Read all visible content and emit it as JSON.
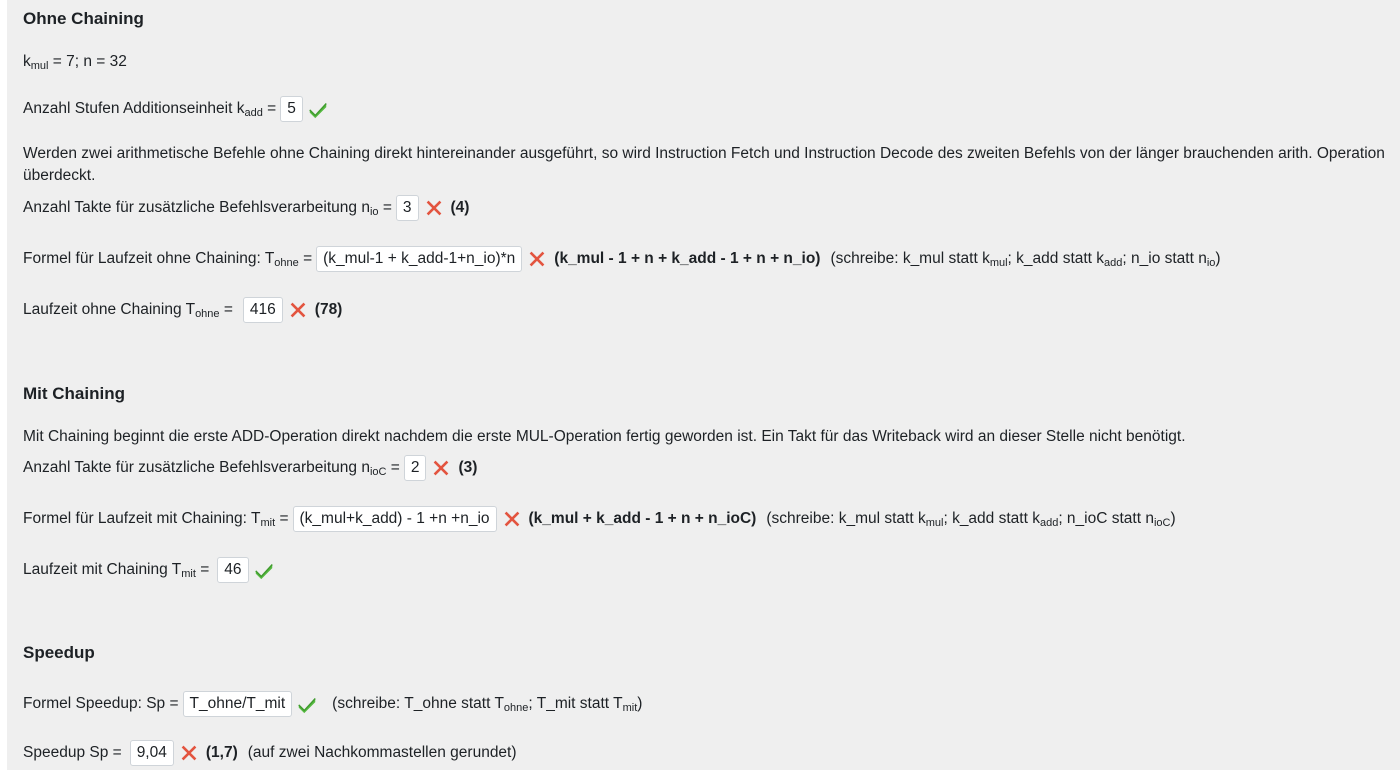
{
  "ohne": {
    "heading": "Ohne Chaining",
    "params": {
      "k": "k",
      "sub": "mul",
      "rest": " = 7; n = 32"
    },
    "stufen": {
      "label": "Anzahl Stufen Additionseinheit k",
      "sub": "add",
      "eq": " =",
      "value": "5",
      "status": "correct"
    },
    "desc": "Werden zwei arithmetische Befehle ohne Chaining direkt hintereinander ausgeführt, so wird Instruction Fetch und Instruction Decode des zweiten Befehls von der länger brauchenden arith. Operation überdeckt.",
    "takte": {
      "label": "Anzahl Takte für zusätzliche Befehlsverarbeitung n",
      "sub": "io",
      "eq": " =",
      "value": "3",
      "status": "wrong",
      "correct": "(4)"
    },
    "formel": {
      "label": "Formel für Laufzeit ohne Chaining: T",
      "sub": "ohne",
      "eq": " =",
      "value": "(k_mul-1 + k_add-1+n_io)*n",
      "status": "wrong",
      "correct": "(k_mul - 1 + n + k_add - 1 + n + n_io)",
      "note": {
        "p1": "(schreibe: k_mul statt k",
        "s1": "mul",
        "p2": "; k_add statt k",
        "s2": "add",
        "p3": "; n_io statt n",
        "s3": "io",
        "p4": ")"
      }
    },
    "laufzeit": {
      "label": "Laufzeit ohne Chaining T",
      "sub": "ohne",
      "eq": " =",
      "value": "416",
      "status": "wrong",
      "correct": "(78)"
    }
  },
  "mit": {
    "heading": "Mit Chaining",
    "desc": "Mit Chaining beginnt die erste ADD-Operation direkt nachdem die erste MUL-Operation fertig geworden ist. Ein Takt für das Writeback wird an dieser Stelle nicht benötigt.",
    "takte": {
      "label": "Anzahl Takte für zusätzliche Befehlsverarbeitung n",
      "sub": "ioC",
      "eq": " =",
      "value": "2",
      "status": "wrong",
      "correct": "(3)"
    },
    "formel": {
      "label": "Formel für Laufzeit mit Chaining: T",
      "sub": "mit",
      "eq": " =",
      "value": "(k_mul+k_add) - 1 +n +n_io",
      "status": "wrong",
      "correct": "(k_mul + k_add - 1 + n + n_ioC)",
      "note": {
        "p1": "(schreibe: k_mul statt k",
        "s1": "mul",
        "p2": "; k_add statt k",
        "s2": "add",
        "p3": "; n_ioC statt n",
        "s3": "ioC",
        "p4": ")"
      }
    },
    "laufzeit": {
      "label": "Laufzeit mit Chaining T",
      "sub": "mit",
      "eq": " =",
      "value": "46",
      "status": "correct"
    }
  },
  "speedup": {
    "heading": "Speedup",
    "formel": {
      "label": "Formel Speedup: Sp =",
      "value": "T_ohne/T_mit",
      "status": "correct",
      "note": {
        "p1": "(schreibe: T_ohne statt T",
        "s1": "ohne",
        "p2": "; T_mit statt T",
        "s2": "mit",
        "p3": ")"
      }
    },
    "wert": {
      "label": "Speedup Sp =",
      "value": "9,04",
      "status": "wrong",
      "correct": "(1,7)",
      "note": "(auf zwei Nachkommastellen gerundet)"
    }
  },
  "icons": {
    "correct": "check-icon",
    "wrong": "cross-icon"
  },
  "colors": {
    "correct": "#55b940",
    "wrong": "#e3543f"
  }
}
